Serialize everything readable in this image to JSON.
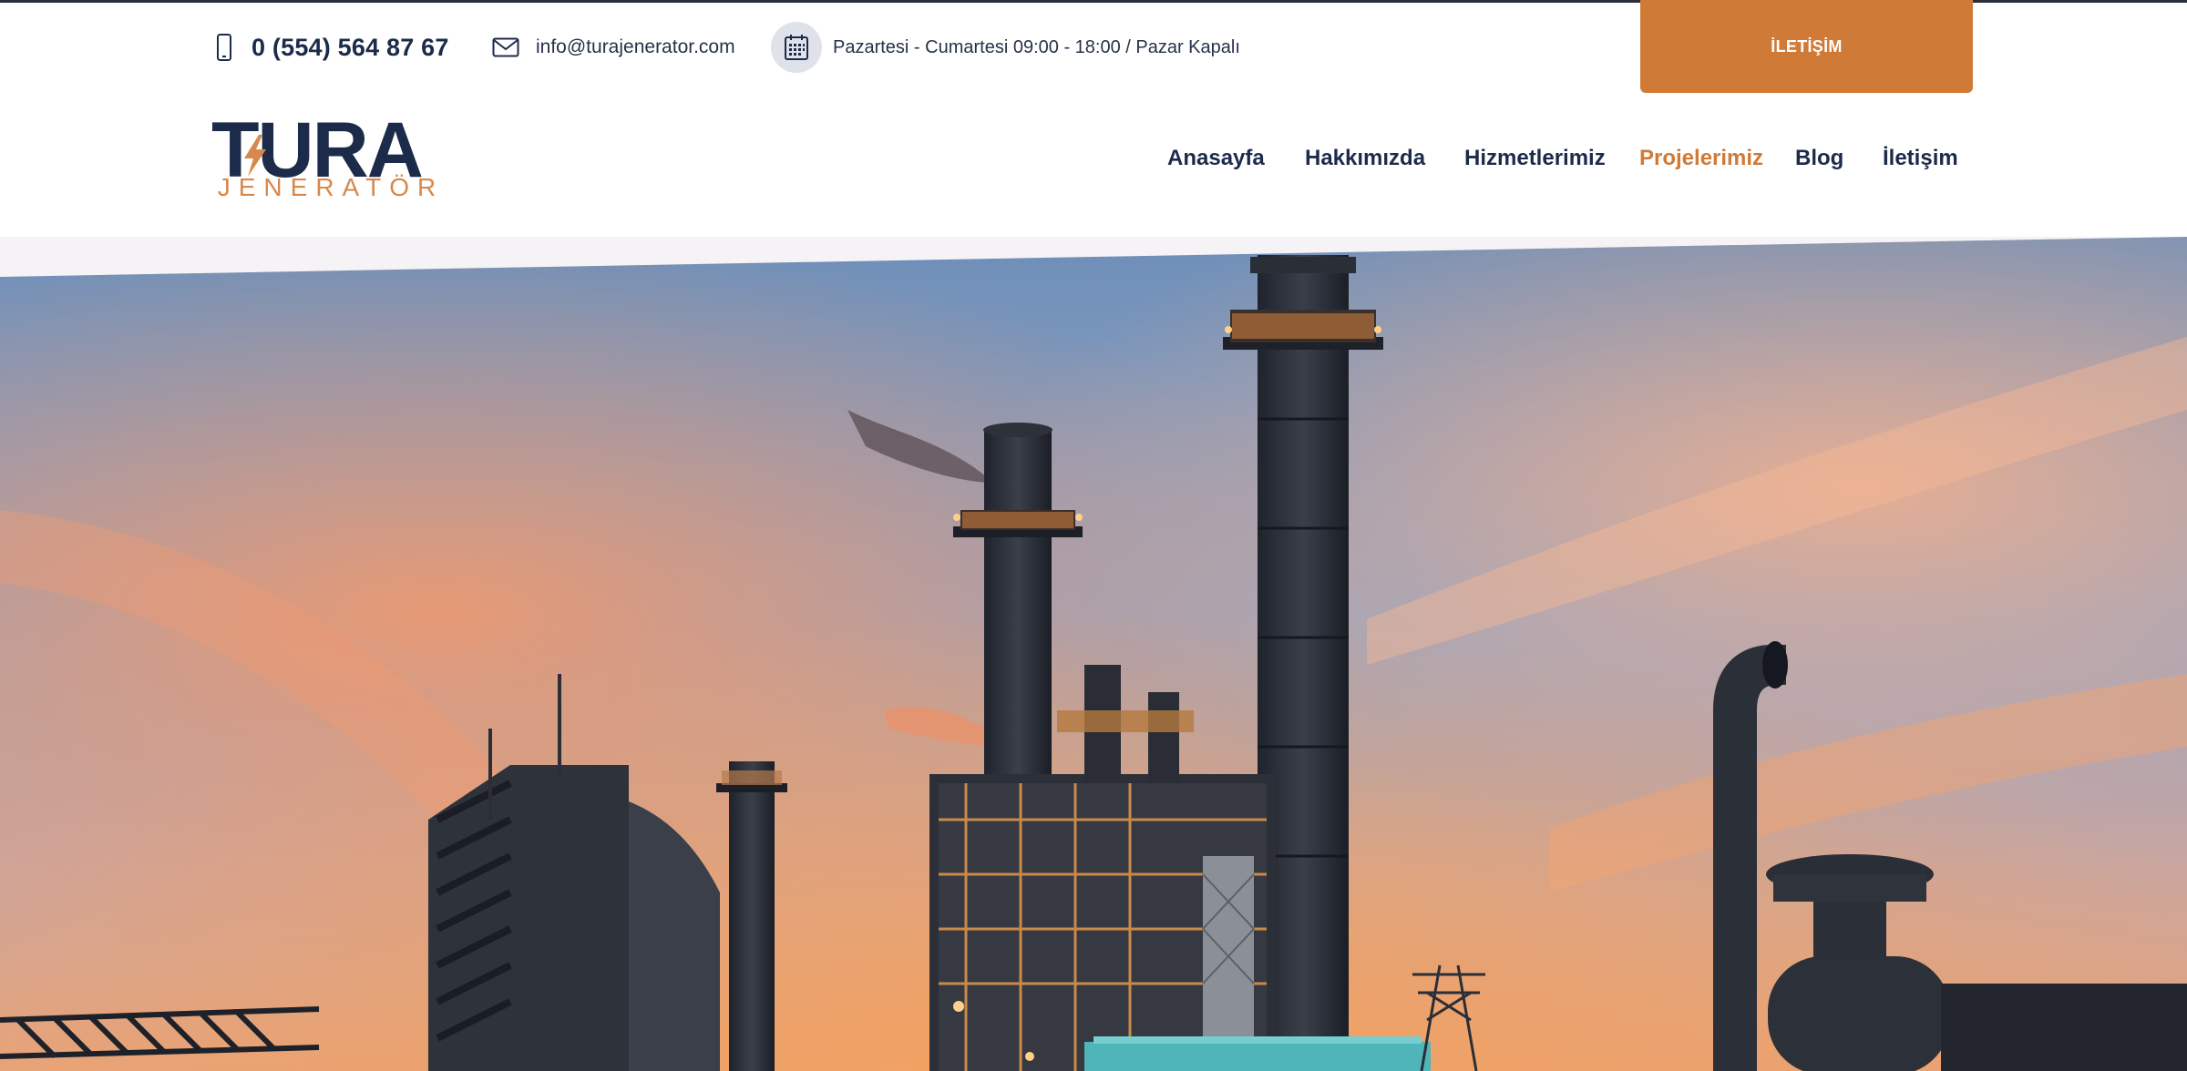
{
  "topbar": {
    "phone": "0 (554) 564 87 67",
    "email": "info@turajenerator.com",
    "hours": "Pazartesi - Cumartesi 09:00 - 18:00 / Pazar Kapalı",
    "cta_label": "İLETİŞİM"
  },
  "logo": {
    "main": "TURA",
    "sub": "JENERATÖR"
  },
  "nav": {
    "items": [
      {
        "label": "Anasayfa"
      },
      {
        "label": "Hakkımızda"
      },
      {
        "label": "Hizmetlerimiz"
      },
      {
        "label": "Projelerimiz",
        "active": true
      },
      {
        "label": "Blog"
      },
      {
        "label": "İletişim"
      }
    ]
  },
  "colors": {
    "accent": "#d07a38",
    "navy": "#1d2b4b"
  },
  "hero": {
    "image": "industrial-power-plant-sunset"
  }
}
